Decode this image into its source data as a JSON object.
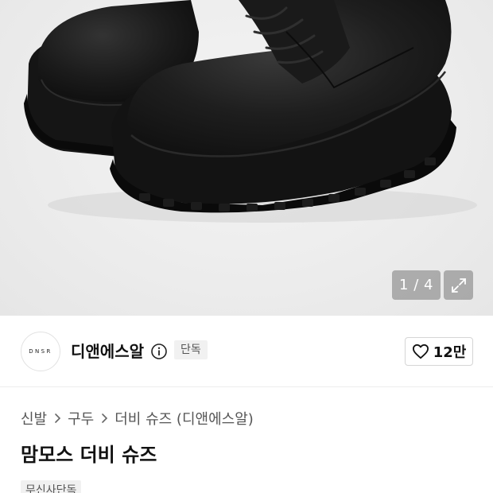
{
  "gallery": {
    "image_alt": "맘모스 더비 슈즈",
    "counter": "1 / 4",
    "expand_icon": "expand-icon"
  },
  "brand": {
    "logo_text": "DNSR",
    "name": "디앤에스알",
    "info_icon": "info-icon",
    "badge": "단독"
  },
  "like": {
    "icon": "heart-outline-icon",
    "count": "12만"
  },
  "breadcrumb": {
    "items": [
      "신발",
      "구두",
      "더비 슈즈 (디앤에스알)"
    ],
    "separator_icon": "chevron-right-icon"
  },
  "product": {
    "title": "맘모스 더비 슈즈",
    "tag": "무신사단독"
  }
}
